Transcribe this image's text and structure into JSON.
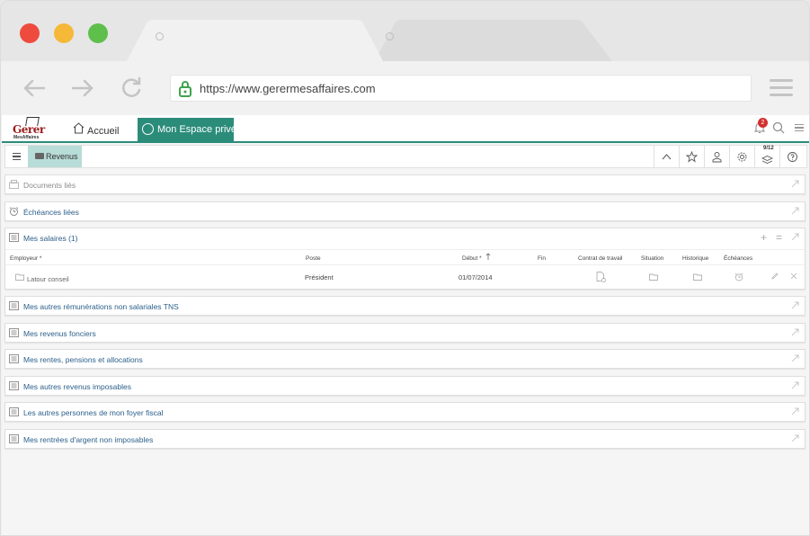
{
  "browser": {
    "url": "https://www.gerermesaffaires.com",
    "traffic_lights": [
      "#ee4b3e",
      "#f6b838",
      "#5ebf4b"
    ]
  },
  "app": {
    "logo": {
      "line1": "Gerer",
      "line2": "MesAffaires"
    },
    "nav": {
      "home_label": "Accueil",
      "private_label": "Mon Espace privé"
    },
    "notifications_count": "2",
    "accent_color": "#2b8c7a",
    "subbar": {
      "tab_label": "Revenus",
      "counter": "9/12"
    },
    "panels": {
      "documents": "Documents liés",
      "echeances": "Échéances liées",
      "salaires": "Mes salaires (1)",
      "tns": "Mes autres rémunérations non salariales TNS",
      "fonciers": "Mes revenus fonciers",
      "rentes": "Mes rentes, pensions et allocations",
      "imposables": "Mes autres revenus imposables",
      "foyer": "Les autres personnes de mon foyer fiscal",
      "non_imposables": "Mes rentrées d'argent non imposables"
    },
    "salaires_table": {
      "columns": {
        "employeur": "Employeur *",
        "poste": "Poste",
        "debut": "Début *",
        "fin": "Fin",
        "contrat": "Contrat de travail",
        "situation": "Situation",
        "historique": "Historique",
        "echeances": "Échéances"
      },
      "rows": [
        {
          "employeur": "Latour conseil",
          "poste": "Président",
          "debut": "01/07/2014",
          "fin": ""
        }
      ]
    }
  }
}
